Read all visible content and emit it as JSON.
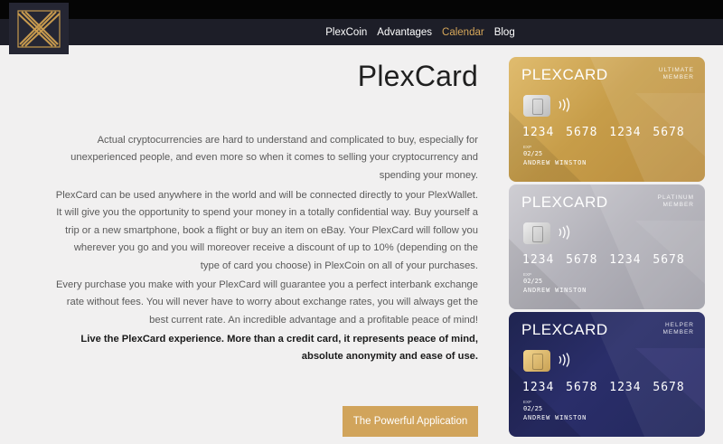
{
  "nav": {
    "items": [
      {
        "label": "PlexCoin",
        "active": false
      },
      {
        "label": "Advantages",
        "active": false
      },
      {
        "label": "Calendar",
        "active": true
      },
      {
        "label": "Blog",
        "active": false
      }
    ]
  },
  "main": {
    "title": "PlexCard",
    "paragraphs": [
      "Actual cryptocurrencies are hard to understand and complicated to buy, especially for unexperienced people, and even more so when it comes to selling your cryptocurrency and spending your money.",
      "PlexCard can be used anywhere in the world and will be connected directly to your PlexWallet. It will give you the opportunity to spend your money in a totally confidential way. Buy yourself a trip or a new smartphone, book a flight or buy an item on eBay. Your PlexCard will follow you wherever you go and you will moreover receive a discount of up to 10% (depending on the type of card you choose) in PlexCoin on all of your purchases.",
      "Every purchase you make with your PlexCard will guarantee you a perfect interbank exchange rate without fees. You will never have to worry about exchange rates, you will always get the best current rate. An incredible advantage and a profitable peace of mind!",
      "Live the PlexCard experience. More than a credit card, it represents peace of mind, absolute anonymity and ease of use."
    ],
    "cta_label": "The Powerful Application"
  },
  "cards": [
    {
      "brand": "PLEXCARD",
      "tier_line1": "ULTIMATE",
      "tier_line2": "MEMBER",
      "number": "1234 5678 1234 5678",
      "exp_label": "EXP",
      "exp": "02/25",
      "holder": "ANDREW WINSTON"
    },
    {
      "brand": "PLEXCARD",
      "tier_line1": "PLATINUM",
      "tier_line2": "MEMBER",
      "number": "1234 5678 1234 5678",
      "exp_label": "EXP",
      "exp": "02/25",
      "holder": "ANDREW WINSTON"
    },
    {
      "brand": "PLEXCARD",
      "tier_line1": "HELPER",
      "tier_line2": "MEMBER",
      "number": "1234 5678 1234 5678",
      "exp_label": "EXP",
      "exp": "02/25",
      "holder": "ANDREW WINSTON"
    }
  ],
  "colors": {
    "accent": "#d1a45b",
    "nav_bg": "#1d1e28",
    "page_bg": "#f1f0f0"
  }
}
